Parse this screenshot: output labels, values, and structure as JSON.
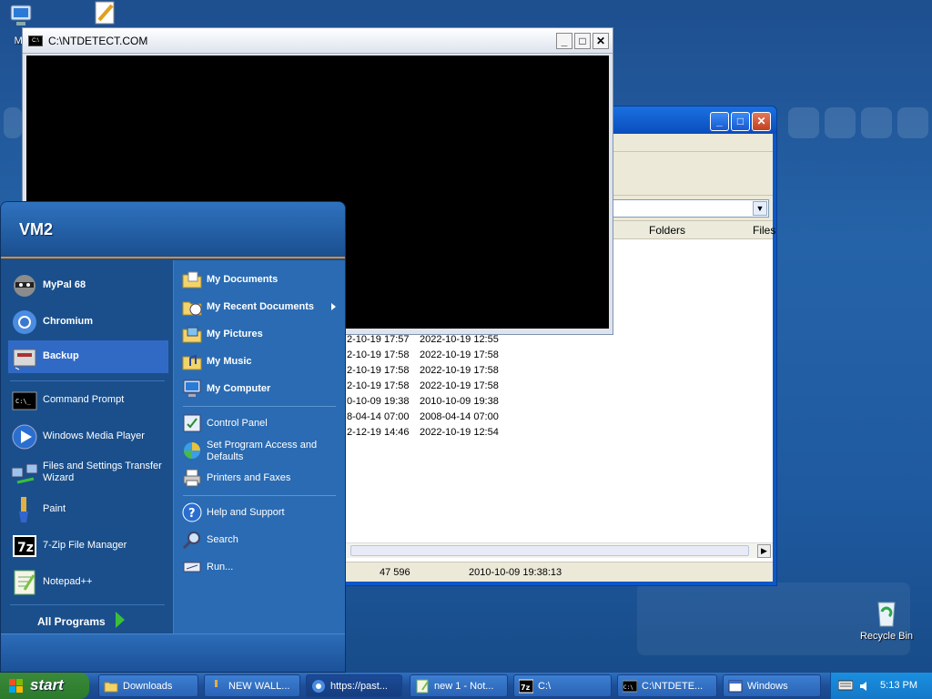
{
  "desktop": {
    "icons": [
      {
        "label": "My",
        "icon": "my-computer-icon"
      },
      {
        "label": "Recycle Bin",
        "icon": "recycle-bin-icon"
      }
    ]
  },
  "console": {
    "title": "C:\\NTDETECT.COM",
    "buttons": {
      "minimize": "_",
      "maximize": "□",
      "close": "✕"
    }
  },
  "explorer": {
    "buttons": {
      "minimize": "_",
      "maximize": "□",
      "close": "✕"
    },
    "columns": [
      "Folders",
      "Files"
    ],
    "rows": [
      {
        "a": "2-10-19 17:57",
        "b": "2022-10-19 12:55"
      },
      {
        "a": "2-10-19 17:58",
        "b": "2022-10-19 17:58"
      },
      {
        "a": "2-10-19 17:58",
        "b": "2022-10-19 17:58"
      },
      {
        "a": "2-10-19 17:58",
        "b": "2022-10-19 17:58"
      },
      {
        "a": "0-10-09 19:38",
        "b": "2010-10-09 19:38"
      },
      {
        "a": "8-04-14 07:00",
        "b": "2008-04-14 07:00"
      },
      {
        "a": "2-12-19 14:46",
        "b": "2022-10-19 12:54"
      }
    ],
    "status": {
      "size": "47 596",
      "date": "2010-10-09 19:38:13"
    }
  },
  "startmenu": {
    "user": "VM2",
    "pinned": [
      {
        "label": "MyPal 68",
        "icon": "mypal-raccoon-icon"
      },
      {
        "label": "Chromium",
        "icon": "chromium-icon"
      },
      {
        "label": "Backup",
        "icon": "backup-icon"
      }
    ],
    "recent": [
      {
        "label": "Command Prompt",
        "icon": "command-prompt-icon"
      },
      {
        "label": "Windows Media Player",
        "icon": "media-player-icon"
      },
      {
        "label": "Files and Settings Transfer Wizard",
        "icon": "transfer-wizard-icon"
      },
      {
        "label": "Paint",
        "icon": "paint-icon"
      },
      {
        "label": "7-Zip File Manager",
        "icon": "7zip-icon"
      },
      {
        "label": "Notepad++",
        "icon": "notepadpp-icon"
      }
    ],
    "all_programs": "All Programs",
    "places": [
      {
        "label": "My Documents",
        "icon": "my-documents-icon"
      },
      {
        "label": "My Recent Documents",
        "icon": "recent-documents-icon"
      },
      {
        "label": "My Pictures",
        "icon": "my-pictures-icon"
      },
      {
        "label": "My Music",
        "icon": "my-music-icon"
      },
      {
        "label": "My Computer",
        "icon": "my-computer-icon"
      }
    ],
    "settings": [
      {
        "label": "Control Panel",
        "icon": "control-panel-icon"
      },
      {
        "label": "Set Program Access and Defaults",
        "icon": "program-access-icon"
      },
      {
        "label": "Printers and Faxes",
        "icon": "printer-icon"
      }
    ],
    "help": [
      {
        "label": "Help and Support",
        "icon": "help-icon"
      },
      {
        "label": "Search",
        "icon": "search-icon"
      },
      {
        "label": "Run...",
        "icon": "run-icon"
      }
    ]
  },
  "taskbar": {
    "start_label": "start",
    "buttons": [
      {
        "label": "Downloads",
        "icon": "folder-icon"
      },
      {
        "label": "NEW WALL...",
        "icon": "paint-icon"
      },
      {
        "label": "https://past...",
        "icon": "chromium-icon"
      },
      {
        "label": "new 1 - Not...",
        "icon": "notepadpp-icon"
      },
      {
        "label": "C:\\",
        "icon": "7zip-icon"
      },
      {
        "label": "C:\\NTDETE...",
        "icon": "command-prompt-icon"
      },
      {
        "label": "Windows",
        "icon": "window-icon"
      }
    ],
    "clock": "5:13 PM"
  }
}
